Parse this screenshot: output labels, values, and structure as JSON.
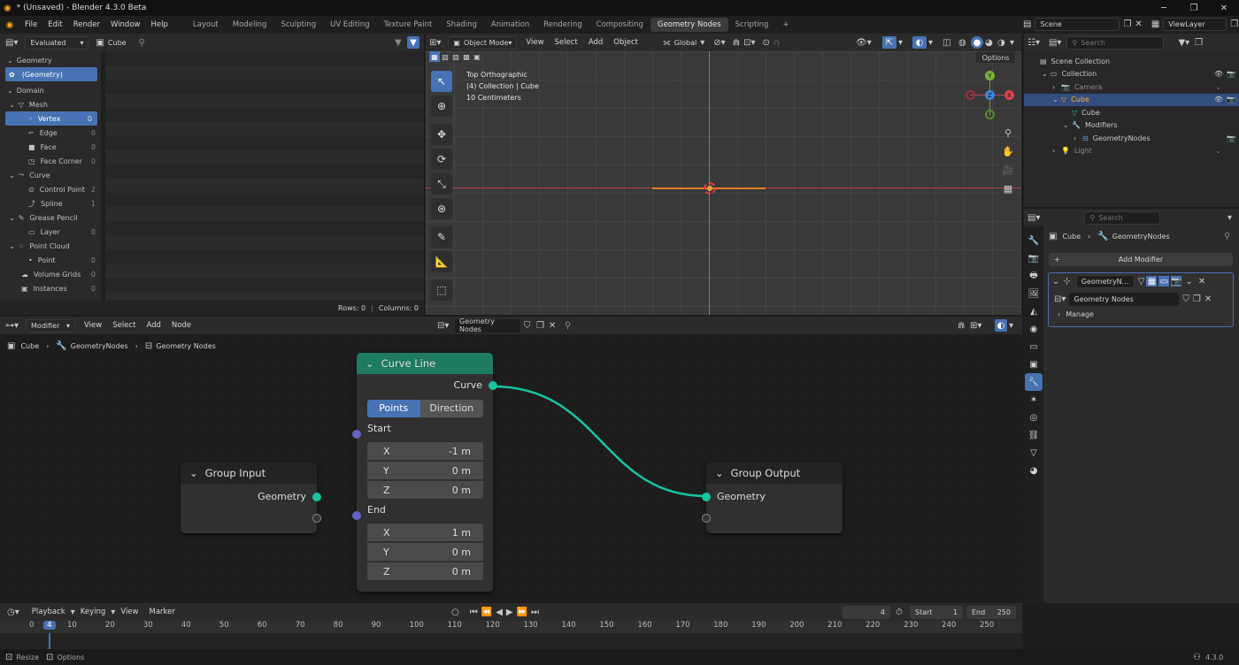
{
  "window": {
    "title": "* (Unsaved) - Blender 4.3.0 Beta",
    "min": "─",
    "max": "❐",
    "close": "✕"
  },
  "menus": [
    "File",
    "Edit",
    "Render",
    "Window",
    "Help"
  ],
  "workspaces": [
    "Layout",
    "Modeling",
    "Sculpting",
    "UV Editing",
    "Texture Paint",
    "Shading",
    "Animation",
    "Rendering",
    "Compositing",
    "Geometry Nodes",
    "Scripting"
  ],
  "active_workspace": "Geometry Nodes",
  "topbar": {
    "scene": "Scene",
    "view_layer": "ViewLayer",
    "add_tab": "+"
  },
  "spreadsheet": {
    "evaluated": "Evaluated",
    "object": "Cube",
    "geometry_header": "Geometry",
    "geometry_item": "(Geometry)",
    "domain_header": "Domain",
    "rows": [
      {
        "label": "Mesh",
        "count": "",
        "level": 0
      },
      {
        "label": "Vertex",
        "count": "0",
        "level": 1,
        "selected": true
      },
      {
        "label": "Edge",
        "count": "0",
        "level": 1
      },
      {
        "label": "Face",
        "count": "0",
        "level": 1
      },
      {
        "label": "Face Corner",
        "count": "0",
        "level": 1
      },
      {
        "label": "Curve",
        "count": "",
        "level": 0
      },
      {
        "label": "Control Point",
        "count": "2",
        "level": 1
      },
      {
        "label": "Spline",
        "count": "1",
        "level": 1
      },
      {
        "label": "Grease Pencil",
        "count": "",
        "level": 0
      },
      {
        "label": "Layer",
        "count": "0",
        "level": 1
      },
      {
        "label": "Point Cloud",
        "count": "",
        "level": 0
      },
      {
        "label": "Point",
        "count": "0",
        "level": 1
      },
      {
        "label": "Volume Grids",
        "count": "0",
        "level": 0
      },
      {
        "label": "Instances",
        "count": "0",
        "level": 0
      }
    ],
    "status_rows": "Rows: 0",
    "status_sep": "|",
    "status_cols": "Columns: 0"
  },
  "viewport": {
    "mode": "Object Mode",
    "menus": [
      "View",
      "Select",
      "Add",
      "Object"
    ],
    "transform": "Global",
    "options": "Options",
    "overlay_lines": [
      "Top Orthographic",
      "(4) Collection | Cube",
      "10 Centimeters"
    ],
    "gizmo": {
      "y": "Y",
      "z": "Z",
      "x": "X"
    }
  },
  "outliner": {
    "search_placeholder": "Search",
    "items": [
      {
        "label": "Scene Collection",
        "indent": 0
      },
      {
        "label": "Collection",
        "indent": 1
      },
      {
        "label": "Camera",
        "indent": 2
      },
      {
        "label": "Cube",
        "indent": 2,
        "selected": true
      },
      {
        "label": "Cube",
        "indent": 3
      },
      {
        "label": "Modifiers",
        "indent": 3
      },
      {
        "label": "GeometryNodes",
        "indent": 4
      },
      {
        "label": "Light",
        "indent": 2
      }
    ]
  },
  "properties": {
    "search_placeholder": "Search",
    "breadcrumb": [
      "Cube",
      "GeometryNodes"
    ],
    "add_modifier": "Add Modifier",
    "modifier_name": "GeometryN...",
    "node_group": "Geometry Nodes",
    "manage": "Manage"
  },
  "node_editor": {
    "type": "Modifier",
    "menus": [
      "View",
      "Select",
      "Add",
      "Node"
    ],
    "tree": "Geometry Nodes",
    "breadcrumb": [
      "Cube",
      "GeometryNodes",
      "Geometry Nodes"
    ],
    "group_input": {
      "title": "Group Input",
      "out": "Geometry"
    },
    "group_output": {
      "title": "Group Output",
      "in": "Geometry"
    },
    "curve_line": {
      "title": "Curve Line",
      "out": "Curve",
      "mode_points": "Points",
      "mode_direction": "Direction",
      "start": "Start",
      "end": "End",
      "start_vals": [
        {
          "axis": "X",
          "val": "-1 m"
        },
        {
          "axis": "Y",
          "val": "0 m"
        },
        {
          "axis": "Z",
          "val": "0 m"
        }
      ],
      "end_vals": [
        {
          "axis": "X",
          "val": "1 m"
        },
        {
          "axis": "Y",
          "val": "0 m"
        },
        {
          "axis": "Z",
          "val": "0 m"
        }
      ]
    }
  },
  "timeline": {
    "menus": [
      "Playback",
      "Keying",
      "View",
      "Marker"
    ],
    "current_frame": "4",
    "start_label": "Start",
    "start": "1",
    "end_label": "End",
    "end": "250",
    "ticks": [
      "0",
      "4",
      "10",
      "20",
      "30",
      "40",
      "50",
      "60",
      "70",
      "80",
      "90",
      "100",
      "110",
      "120",
      "130",
      "140",
      "150",
      "160",
      "170",
      "180",
      "190",
      "200",
      "210",
      "220",
      "230",
      "240",
      "250"
    ]
  },
  "statusbar": {
    "left1": "Resize",
    "left2": "Options",
    "version": "4.3.0"
  }
}
